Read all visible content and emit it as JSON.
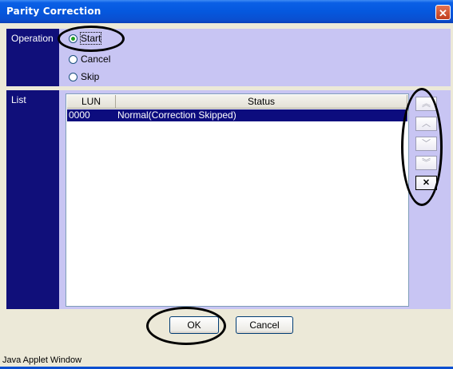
{
  "window": {
    "title": "Parity Correction",
    "close_glyph": "✕"
  },
  "operation": {
    "label": "Operation",
    "options": [
      {
        "label": "Start",
        "checked": true
      },
      {
        "label": "Cancel",
        "checked": false
      },
      {
        "label": "Skip",
        "checked": false
      }
    ]
  },
  "list": {
    "label": "List",
    "columns": [
      "LUN",
      "Status"
    ],
    "rows": [
      {
        "lun": "0000",
        "status": "Normal(Correction Skipped)"
      }
    ],
    "side_buttons": [
      {
        "icon": "double-chevron-up-icon",
        "glyph": "︽"
      },
      {
        "icon": "chevron-up-icon",
        "glyph": "︿"
      },
      {
        "icon": "chevron-down-icon",
        "glyph": "﹀"
      },
      {
        "icon": "double-chevron-down-icon",
        "glyph": "︾"
      },
      {
        "icon": "delete-x-icon",
        "glyph": "✕"
      }
    ]
  },
  "footer": {
    "ok_label": "OK",
    "cancel_label": "Cancel",
    "status_text": "Java Applet Window"
  },
  "colors": {
    "title_bar": "#0558de",
    "label_panel": "#100f7a",
    "content_panel": "#c8c5f3",
    "selected_row": "#0c0c7e"
  }
}
